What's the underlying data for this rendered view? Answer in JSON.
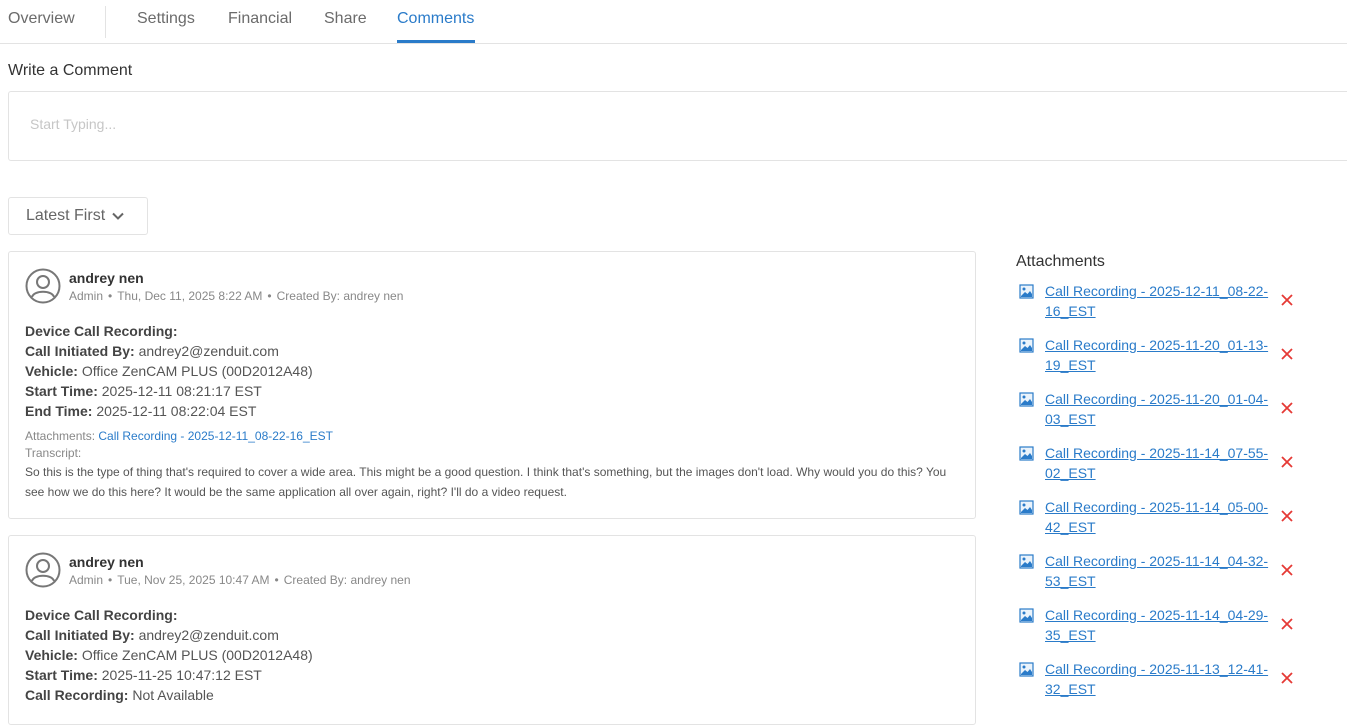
{
  "tabs": [
    {
      "label": "Overview",
      "active": false
    },
    {
      "label": "Settings",
      "active": false
    },
    {
      "label": "Financial",
      "active": false
    },
    {
      "label": "Share",
      "active": false
    },
    {
      "label": "Comments",
      "active": true
    }
  ],
  "write_comment": {
    "title": "Write a Comment",
    "placeholder": "Start Typing..."
  },
  "sort": {
    "label": "Latest First"
  },
  "comments": [
    {
      "author": "andrey nen",
      "role": "Admin",
      "date": "Thu, Dec 11, 2025 8:22 AM",
      "created_by": "Created By: andrey nen",
      "heading": "Device Call Recording:",
      "fields": [
        {
          "label": "Call Initiated By:",
          "value": "andrey2@zenduit.com"
        },
        {
          "label": "Vehicle:",
          "value": "Office ZenCAM PLUS (00D2012A48)"
        },
        {
          "label": "Start Time:",
          "value": "2025-12-11 08:21:17 EST"
        },
        {
          "label": "End Time:",
          "value": "2025-12-11 08:22:04 EST"
        }
      ],
      "attachments_label": "Attachments:",
      "attachment_link": "Call Recording - 2025-12-11_08-22-16_EST",
      "transcript_label": "Transcript:",
      "transcript": "So this is the type of thing that's required to cover a wide area. This might be a good question. I think that's something, but the images don't load. Why would you do this? You see how we do this here? It would be the same application all over again, right? I'll do a video request."
    },
    {
      "author": "andrey nen",
      "role": "Admin",
      "date": "Tue, Nov 25, 2025 10:47 AM",
      "created_by": "Created By: andrey nen",
      "heading": "Device Call Recording:",
      "fields": [
        {
          "label": "Call Initiated By:",
          "value": "andrey2@zenduit.com"
        },
        {
          "label": "Vehicle:",
          "value": "Office ZenCAM PLUS (00D2012A48)"
        },
        {
          "label": "Start Time:",
          "value": "2025-11-25 10:47:12 EST"
        },
        {
          "label": "Call Recording:",
          "value": "Not Available"
        }
      ]
    }
  ],
  "attachments": {
    "title": "Attachments",
    "items": [
      "Call Recording - 2025-12-11_08-22-16_EST",
      "Call Recording - 2025-11-20_01-13-19_EST",
      "Call Recording - 2025-11-20_01-04-03_EST",
      "Call Recording - 2025-11-14_07-55-02_EST",
      "Call Recording - 2025-11-14_05-00-42_EST",
      "Call Recording - 2025-11-14_04-32-53_EST",
      "Call Recording - 2025-11-14_04-29-35_EST",
      "Call Recording - 2025-11-13_12-41-32_EST"
    ]
  },
  "colors": {
    "accent": "#2a7bc9",
    "delete": "#e53935"
  },
  "icons": {
    "avatar": "user-circle-icon",
    "attachment": "image-file-icon",
    "delete": "close-icon",
    "sort": "chevron-down-icon"
  }
}
